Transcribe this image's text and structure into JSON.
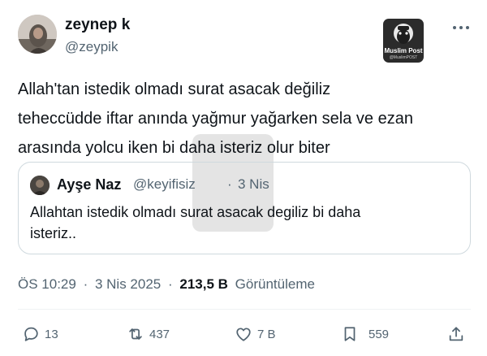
{
  "author": {
    "display_name": "zeynep k",
    "handle": "@zeypik"
  },
  "badge": {
    "title": "Muslim Post",
    "subtitle": "@MuslimPOST"
  },
  "tweet": {
    "lines": [
      "Allah'tan istedik olmadı surat asacak değiliz",
      "teheccüdde iftar anında yağmur yağarken sela ve ezan",
      "arasında yolcu iken bi daha isteriz olur biter"
    ]
  },
  "quote": {
    "display_name": "Ayşe Naz",
    "handle": "@keyifisiz",
    "separator": "·",
    "date": "3 Nis",
    "lines": [
      "Allahtan istedik olmadı surat asacak degiliz bi daha",
      "isteriz.."
    ]
  },
  "meta": {
    "time": "ÖS 10:29",
    "separator": "·",
    "date": "3 Nis 2025",
    "views_count": "213,5 B",
    "views_label": "Görüntüleme"
  },
  "actions": {
    "replies": "13",
    "reposts": "437",
    "likes": "7 B",
    "bookmarks": "559"
  },
  "colors": {
    "text": "#0f1419",
    "secondary": "#536471",
    "border": "#cfd9de"
  },
  "icons": [
    "more-icon",
    "reply-icon",
    "repost-icon",
    "like-icon",
    "bookmark-icon",
    "share-icon"
  ]
}
